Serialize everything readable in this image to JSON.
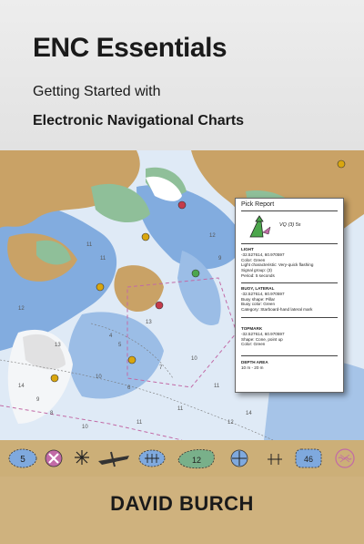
{
  "cover": {
    "title": "ENC Essentials",
    "subtitle_line1": "Getting Started with",
    "subtitle_line2": "Electronic Navigational Charts",
    "author": "DAVID BURCH"
  },
  "pick_report": {
    "title": "Pick Report",
    "symbol_label": "VQ (3) 5s",
    "sections": [
      {
        "heading": "LIGHT",
        "lines": [
          "-32.527614, 60.970597",
          "Color: Green",
          "Light characteristic: Very-quick flashing",
          "Signal group: (3)",
          "Period: 5 seconds"
        ]
      },
      {
        "heading": "BUOY, LATERAL",
        "lines": [
          "-32.527614, 60.970597",
          "Buoy shape: Pillar",
          "Buoy color: Green",
          "Category: Starboard-hand lateral mark"
        ]
      },
      {
        "heading": "TOPMARK",
        "lines": [
          "-32.527614, 60.970597",
          "Shape: Cone, point up",
          "Color: Green"
        ]
      },
      {
        "heading": "DEPTH AREA",
        "lines": [
          "10 m - 20 m"
        ]
      }
    ]
  },
  "chart_labels": {
    "soundings": [
      "11",
      "11",
      "12",
      "12",
      "13",
      "14",
      "9",
      "8",
      "11",
      "4",
      "5",
      "6",
      "7",
      "10",
      "11",
      "13",
      "10",
      "9",
      "12",
      "14",
      "11",
      "10"
    ]
  },
  "symbols_strip": {
    "items": [
      "depth-5-icon",
      "danger-cross-icon",
      "rock-star-icon",
      "wreck-icon",
      "obstruction-icon",
      "depth-area-12-icon",
      "buoy-green-icon",
      "foul-ground-icon",
      "depth-46-icon",
      "anchorage-icon"
    ],
    "labels": {
      "five": "5",
      "twelve": "12",
      "fortysix": "46"
    }
  },
  "colors": {
    "header_bg": "#e6e6e6",
    "tan": "#cfb27e",
    "land": "#c8a266",
    "shallow_blue": "#7fa9de",
    "deep": "#e8f0f8",
    "green_intertidal": "#8fbf9a"
  }
}
